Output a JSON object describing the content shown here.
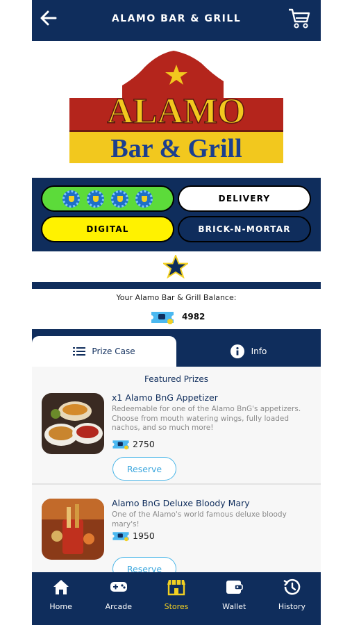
{
  "header": {
    "title": "ALAMO BAR & GRILL",
    "back_icon": "arrow-left-icon",
    "cart_icon": "shopping-cart-icon"
  },
  "logo": {
    "line1": "ALAMO",
    "line2": "Bar & Grill"
  },
  "tags": {
    "delivery": "DELIVERY",
    "digital": "DIGITAL",
    "brick": "BRICK-N-MORTAR"
  },
  "balance": {
    "label": "Your Alamo Bar & Grill Balance:",
    "value": "4982"
  },
  "tabs": {
    "prize_case": "Prize Case",
    "info": "Info"
  },
  "featured_title": "Featured Prizes",
  "prizes": [
    {
      "name": "x1 Alamo BnG Appetizer",
      "description": "Redeemable for one of the Alamo BnG's appetizers. Choose from mouth watering wings, fully loaded nachos, and so much more!",
      "cost": "2750",
      "button": "Reserve"
    },
    {
      "name": "Alamo BnG Deluxe Bloody Mary",
      "description": "One of the Alamo's world famous deluxe bloody mary's!",
      "cost": "1950",
      "button": "Reserve"
    }
  ],
  "nav": [
    {
      "label": "Home",
      "icon": "home-icon"
    },
    {
      "label": "Arcade",
      "icon": "gamepad-icon"
    },
    {
      "label": "Stores",
      "icon": "store-icon"
    },
    {
      "label": "Wallet",
      "icon": "wallet-icon"
    },
    {
      "label": "History",
      "icon": "history-icon"
    }
  ],
  "colors": {
    "navy": "#0f2d5c",
    "active": "#f2d022",
    "green_pill": "#5cdb3a",
    "yellow_pill": "#fff200",
    "logo_red": "#b4251c",
    "link_blue": "#3aa6dd"
  }
}
